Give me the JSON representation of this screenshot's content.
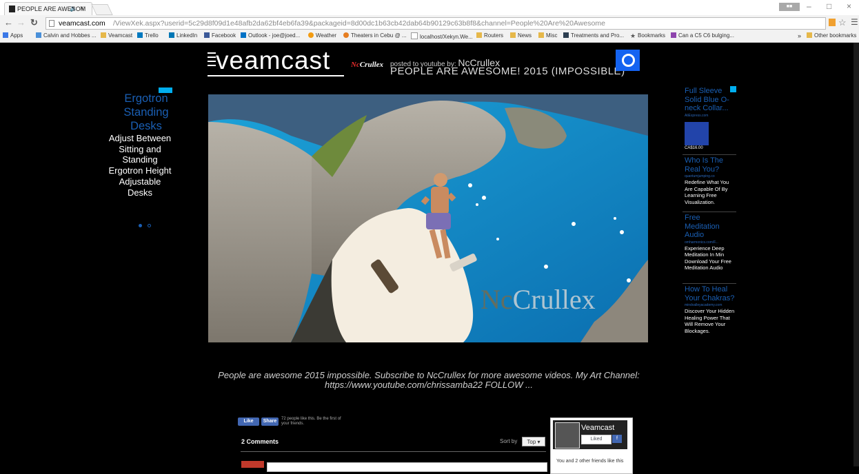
{
  "browser": {
    "tab_title": "PEOPLE ARE AWESOM",
    "tab_close": "×",
    "window_controls": [
      "–",
      "□",
      "×"
    ],
    "url_host": "veamcast.com",
    "url_path": "/ViewXek.aspx?userid=5c29d8f09d1e48afb2da62bf4eb6fa39&packageid=8d00dc1b63cb42dab64b90129c63b8f8&channel=People%20Are%20Awesome",
    "bookmarks": [
      "Apps",
      "Calvin and Hobbes ...",
      "Veamcast",
      "Trello",
      "LinkedIn",
      "Facebook",
      "Outlook - joe@joed...",
      "Weather",
      "Theaters in Cebu @ ...",
      "localhost/Xekyn.We...",
      "Routers",
      "News",
      "Misc",
      "Treatments and Pro...",
      "Bookmarks",
      "Can a C5 C6 bulging..."
    ],
    "bookmarks_more": "»",
    "other_bookmarks": "Other bookmarks"
  },
  "header": {
    "logo": "veamcast",
    "channel_logo_nc": "Nc",
    "channel_logo_rest": "Crullex",
    "posted_by_label": "posted to youtube by:",
    "uploader": "NcCrullex",
    "video_title": "PEOPLE ARE AWESOME! 2015 (IMPOSSIBLE)"
  },
  "left_ad": {
    "title": "Ergotron Standing Desks",
    "body": "Adjust Between Sitting and Standing Ergotron Height Adjustable Desks"
  },
  "video": {
    "watermark_nc": "Nc",
    "watermark_rest": "Crullex"
  },
  "right_ads": [
    {
      "title": "Full Sleeve Solid Blue O-neck Collar...",
      "domain": "AliExpress.com",
      "price": "CA$16.00"
    },
    {
      "title": "Who Is The Real You?",
      "domain": "quantumjumping.co",
      "body": "Redefine What You Are Capable Of By Learning Free Visualization."
    },
    {
      "title": "Free Meditation Audio",
      "domain": "omharmonics.com/F...",
      "body": "Experience Deep Meditation In Min Download Your Free Meditation Audio"
    },
    {
      "title": "How To Heal Your Chakras?",
      "domain": "mindvalleyacademy.com",
      "body": "Discover Your Hidden Healing Power That Will Remove Your Blockages."
    }
  ],
  "description": "People are awesome 2015 impossible. Subscribe to NcCrullex for more awesome videos. My Art Channel: https://www.youtube.com/chrissamba22 FOLLOW ...",
  "facebook": {
    "like_label": "Like",
    "share_label": "Share",
    "like_count_text": "72 people like this. Be the first of your friends.",
    "comments_count": "2 Comments",
    "sort_by_label": "Sort by",
    "sort_value": "Top",
    "page_name": "Veamcast",
    "liked_label": "Liked",
    "friends_text": "You and 2 other friends like this"
  },
  "colors": {
    "ad_title": "#1a5fb4",
    "fb_blue": "#4267b2",
    "channel_icon": "#1463f1",
    "page_bg": "#000000"
  }
}
